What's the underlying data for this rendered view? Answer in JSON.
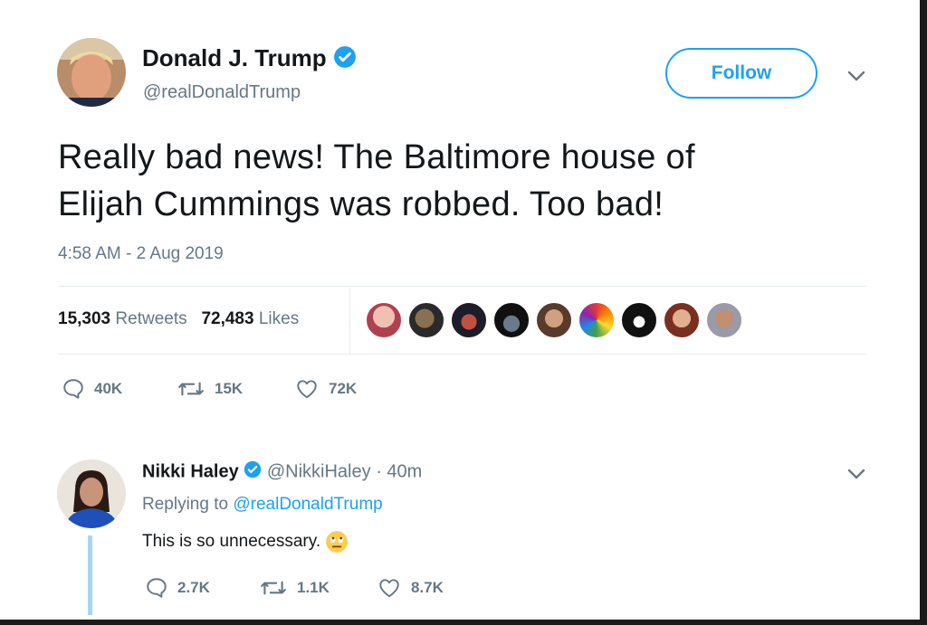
{
  "tweet": {
    "author_name": "Donald J. Trump",
    "author_handle": "@realDonaldTrump",
    "follow_label": "Follow",
    "text_line1": "Really bad news! The Baltimore house of",
    "text_line2": "Elijah Cummings was robbed. Too bad!",
    "timestamp": "4:58 AM - 2 Aug 2019",
    "retweet_count": "15,303",
    "retweet_label": "Retweets",
    "like_count": "72,483",
    "like_label": "Likes",
    "actions": {
      "replies": "40K",
      "retweets": "15K",
      "likes": "72K"
    }
  },
  "reply": {
    "author_name": "Nikki Haley",
    "author_handle": "@NikkiHaley",
    "age": "· 40m",
    "replying_prefix": "Replying to",
    "replying_to": "@realDonaldTrump",
    "text": "This is so unnecessary.",
    "emoji": "🙄",
    "actions": {
      "replies": "2.7K",
      "retweets": "1.1K",
      "likes": "8.7K"
    }
  },
  "colors": {
    "accent": "#1da1f2",
    "muted": "#657786",
    "text": "#14171a"
  }
}
